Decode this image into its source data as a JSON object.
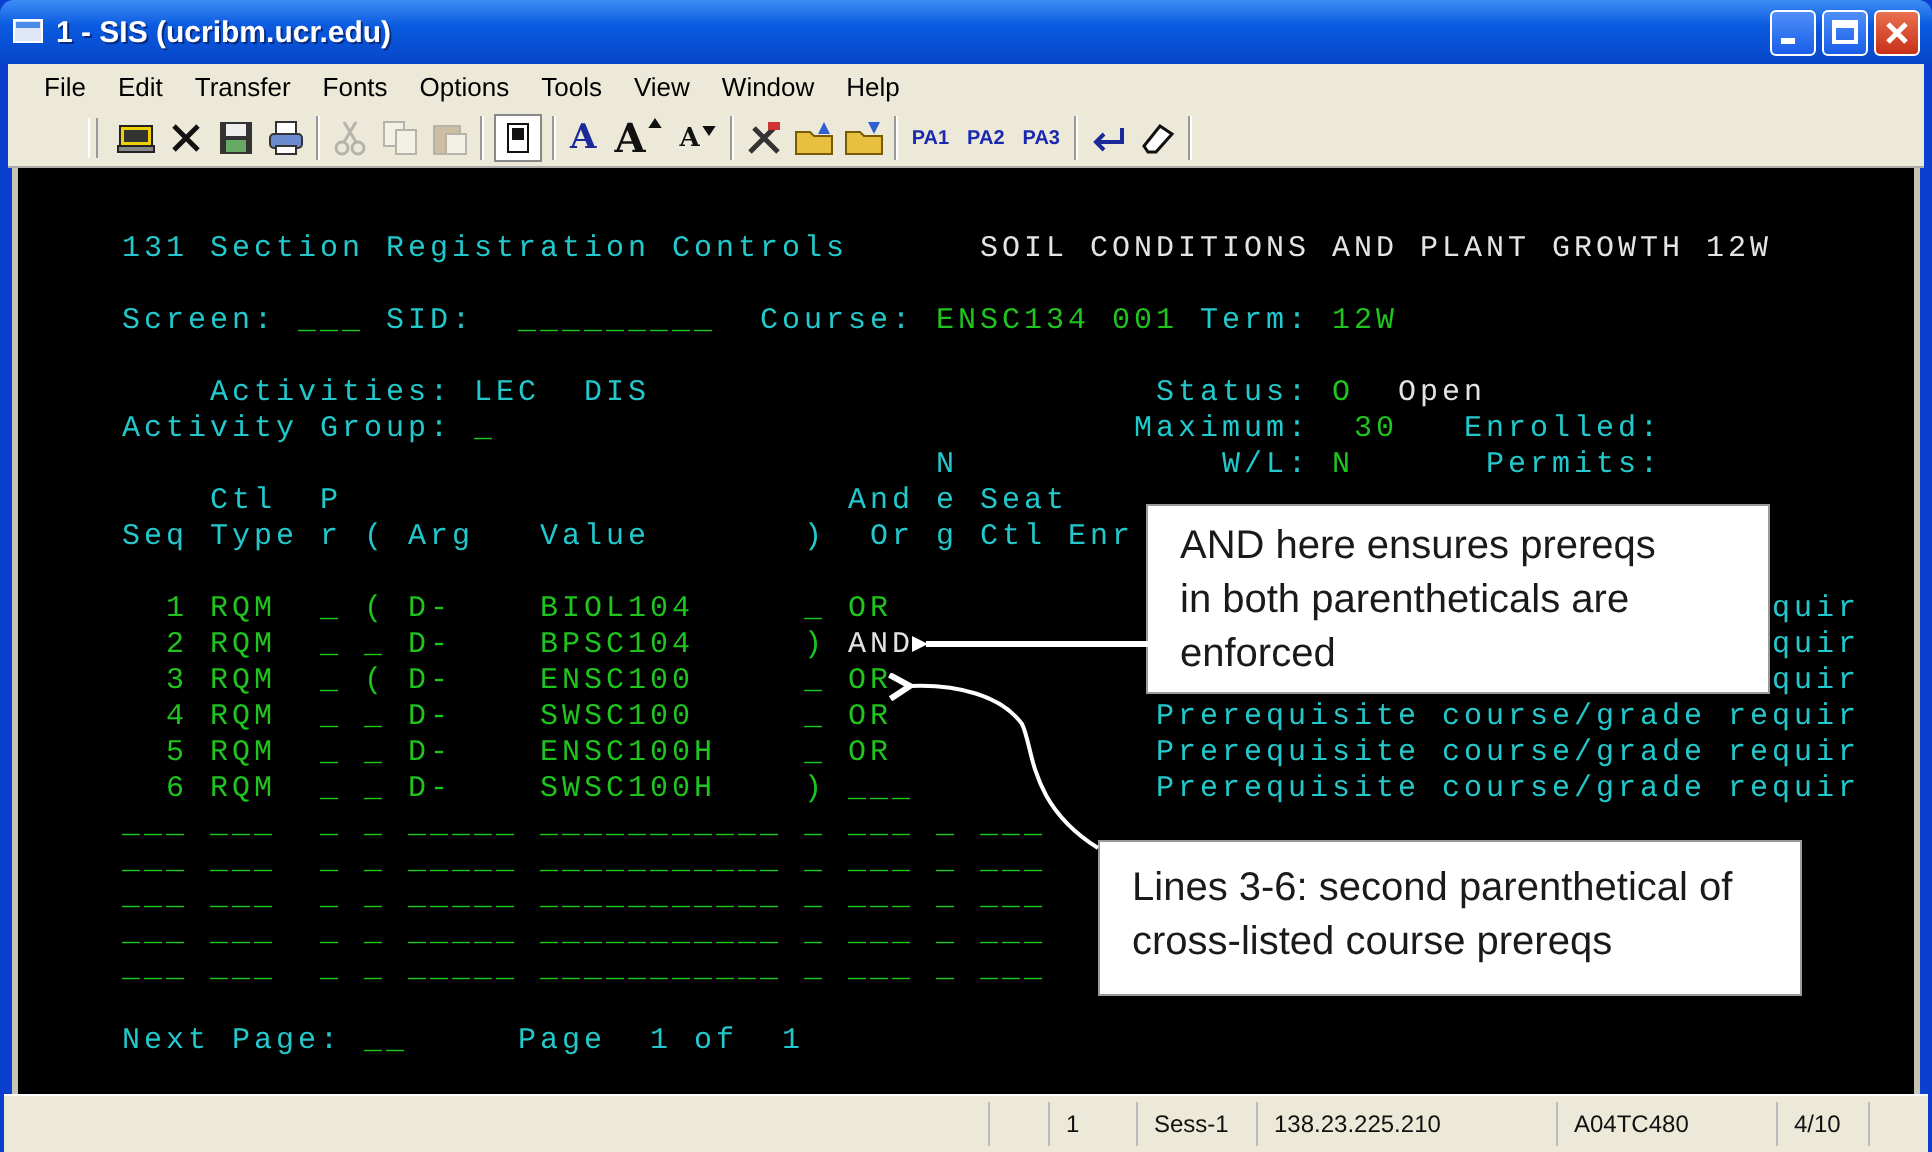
{
  "window": {
    "title": "1 - SIS (ucribm.ucr.edu)"
  },
  "menu": [
    "File",
    "Edit",
    "Transfer",
    "Fonts",
    "Options",
    "Tools",
    "View",
    "Window",
    "Help"
  ],
  "toolbar": {
    "clipboard_buttons": [
      {
        "disabled": true
      },
      {
        "disabled": true
      },
      {
        "disabled": true
      }
    ],
    "font_buttons": [
      {
        "label": "A",
        "kind": "plain"
      },
      {
        "label": "A",
        "kind": "grow"
      },
      {
        "label": "A",
        "kind": "shrink"
      }
    ],
    "pa_buttons": [
      "PA1",
      "PA2",
      "PA3"
    ]
  },
  "terminal": {
    "lines": [
      [
        {
          "text": "131 Section Registration Controls",
          "kind": "label"
        },
        {
          "text": "SOIL CONDITIONS AND PLANT GROWTH 12W",
          "kind": "bright"
        }
      ],
      [
        {
          "text": "Screen:",
          "kind": "label"
        },
        {
          "text": "___",
          "kind": "field"
        },
        {
          "text": "SID:",
          "kind": "label"
        },
        {
          "text": "_________",
          "kind": "field"
        },
        {
          "text": "Course:",
          "kind": "label"
        },
        {
          "text": "ENSC134 001",
          "kind": "value"
        },
        {
          "text": "Term:",
          "kind": "label"
        },
        {
          "text": "12W",
          "kind": "value"
        }
      ],
      [
        {
          "text": "Activities:",
          "kind": "label"
        },
        {
          "text": "LEC  DIS",
          "kind": "label"
        },
        {
          "text": "Status:",
          "kind": "label"
        },
        {
          "text": "O",
          "kind": "value"
        },
        {
          "text": "Open",
          "kind": "bright"
        }
      ],
      [
        {
          "text": "Activity Group:",
          "kind": "label"
        },
        {
          "text": "_",
          "kind": "field"
        },
        {
          "text": "Maximum:",
          "kind": "label"
        },
        {
          "text": "30",
          "kind": "value"
        },
        {
          "text": "Enrolled:",
          "kind": "label"
        }
      ],
      [
        {
          "text": "N",
          "kind": "label"
        },
        {
          "text": "W/L:",
          "kind": "label"
        },
        {
          "text": "N",
          "kind": "value"
        },
        {
          "text": "Permits:",
          "kind": "label"
        }
      ],
      [
        {
          "text": "Ctl",
          "kind": "label"
        },
        {
          "text": "P",
          "kind": "label"
        },
        {
          "text": "And",
          "kind": "label"
        },
        {
          "text": "e",
          "kind": "label"
        },
        {
          "text": "Seat",
          "kind": "label"
        }
      ],
      [
        {
          "text": "Seq",
          "kind": "label"
        },
        {
          "text": "Type",
          "kind": "label"
        },
        {
          "text": "r",
          "kind": "label"
        },
        {
          "text": "(",
          "kind": "label"
        },
        {
          "text": "Arg",
          "kind": "label"
        },
        {
          "text": "Value",
          "kind": "label"
        },
        {
          "text": ")",
          "kind": "label"
        },
        {
          "text": "Or",
          "kind": "label"
        },
        {
          "text": "g",
          "kind": "label"
        },
        {
          "text": "Ctl",
          "kind": "label"
        },
        {
          "text": "Enr",
          "kind": "label"
        }
      ],
      [
        {
          "text": "1",
          "kind": "value"
        },
        {
          "text": "RQM",
          "kind": "value"
        },
        {
          "text": "_",
          "kind": "field"
        },
        {
          "text": "(",
          "kind": "field"
        },
        {
          "text": "D-",
          "kind": "value"
        },
        {
          "text": "BIOL104",
          "kind": "value"
        },
        {
          "text": "_",
          "kind": "field"
        },
        {
          "text": "OR",
          "kind": "value"
        },
        {
          "text": "quir",
          "kind": "label"
        }
      ],
      [
        {
          "text": "2",
          "kind": "value"
        },
        {
          "text": "RQM",
          "kind": "value"
        },
        {
          "text": "_",
          "kind": "field"
        },
        {
          "text": "_",
          "kind": "field"
        },
        {
          "text": "D-",
          "kind": "value"
        },
        {
          "text": "BPSC104",
          "kind": "value"
        },
        {
          "text": ")",
          "kind": "field"
        },
        {
          "text": "AND",
          "kind": "bright"
        },
        {
          "text": "quir",
          "kind": "label"
        }
      ],
      [
        {
          "text": "3",
          "kind": "value"
        },
        {
          "text": "RQM",
          "kind": "value"
        },
        {
          "text": "_",
          "kind": "field"
        },
        {
          "text": "(",
          "kind": "field"
        },
        {
          "text": "D-",
          "kind": "value"
        },
        {
          "text": "ENSC100",
          "kind": "value"
        },
        {
          "text": "_",
          "kind": "field"
        },
        {
          "text": "OR",
          "kind": "value"
        },
        {
          "text": "quir",
          "kind": "label"
        }
      ],
      [
        {
          "text": "4",
          "kind": "value"
        },
        {
          "text": "RQM",
          "kind": "value"
        },
        {
          "text": "_",
          "kind": "field"
        },
        {
          "text": "_",
          "kind": "field"
        },
        {
          "text": "D-",
          "kind": "value"
        },
        {
          "text": "SWSC100",
          "kind": "value"
        },
        {
          "text": "_",
          "kind": "field"
        },
        {
          "text": "OR",
          "kind": "value"
        },
        {
          "text": "Prerequisite course/grade requir",
          "kind": "label"
        }
      ],
      [
        {
          "text": "5",
          "kind": "value"
        },
        {
          "text": "RQM",
          "kind": "value"
        },
        {
          "text": "_",
          "kind": "field"
        },
        {
          "text": "_",
          "kind": "field"
        },
        {
          "text": "D-",
          "kind": "value"
        },
        {
          "text": "ENSC100H",
          "kind": "value"
        },
        {
          "text": "_",
          "kind": "field"
        },
        {
          "text": "OR",
          "kind": "value"
        },
        {
          "text": "Prerequisite course/grade requir",
          "kind": "label"
        }
      ],
      [
        {
          "text": "6",
          "kind": "value"
        },
        {
          "text": "RQM",
          "kind": "value"
        },
        {
          "text": "_",
          "kind": "field"
        },
        {
          "text": "_",
          "kind": "field"
        },
        {
          "text": "D-",
          "kind": "value"
        },
        {
          "text": "SWSC100H",
          "kind": "value"
        },
        {
          "text": ")",
          "kind": "field"
        },
        {
          "text": "___",
          "kind": "field"
        },
        {
          "text": "Prerequisite course/grade requir",
          "kind": "label"
        }
      ],
      [
        {
          "text": "___",
          "kind": "field"
        },
        {
          "text": "___",
          "kind": "field"
        },
        {
          "text": "_",
          "kind": "field"
        },
        {
          "text": "_",
          "kind": "field"
        },
        {
          "text": "_____",
          "kind": "field"
        },
        {
          "text": "___________",
          "kind": "field"
        },
        {
          "text": "_",
          "kind": "field"
        },
        {
          "text": "___",
          "kind": "field"
        },
        {
          "text": "_",
          "kind": "field"
        },
        {
          "text": "___",
          "kind": "field"
        }
      ],
      [
        {
          "text": "___",
          "kind": "field"
        },
        {
          "text": "___",
          "kind": "field"
        },
        {
          "text": "_",
          "kind": "field"
        },
        {
          "text": "_",
          "kind": "field"
        },
        {
          "text": "_____",
          "kind": "field"
        },
        {
          "text": "___________",
          "kind": "field"
        },
        {
          "text": "_",
          "kind": "field"
        },
        {
          "text": "___",
          "kind": "field"
        },
        {
          "text": "_",
          "kind": "field"
        },
        {
          "text": "___",
          "kind": "field"
        }
      ],
      [
        {
          "text": "___",
          "kind": "field"
        },
        {
          "text": "___",
          "kind": "field"
        },
        {
          "text": "_",
          "kind": "field"
        },
        {
          "text": "_",
          "kind": "field"
        },
        {
          "text": "_____",
          "kind": "field"
        },
        {
          "text": "___________",
          "kind": "field"
        },
        {
          "text": "_",
          "kind": "field"
        },
        {
          "text": "___",
          "kind": "field"
        },
        {
          "text": "_",
          "kind": "field"
        },
        {
          "text": "___",
          "kind": "field"
        }
      ],
      [
        {
          "text": "___",
          "kind": "field"
        },
        {
          "text": "___",
          "kind": "field"
        },
        {
          "text": "_",
          "kind": "field"
        },
        {
          "text": "_",
          "kind": "field"
        },
        {
          "text": "_____",
          "kind": "field"
        },
        {
          "text": "___________",
          "kind": "field"
        },
        {
          "text": "_",
          "kind": "field"
        },
        {
          "text": "___",
          "kind": "field"
        },
        {
          "text": "_",
          "kind": "field"
        },
        {
          "text": "___",
          "kind": "field"
        }
      ],
      [
        {
          "text": "___",
          "kind": "field"
        },
        {
          "text": "___",
          "kind": "field"
        },
        {
          "text": "_",
          "kind": "field"
        },
        {
          "text": "_",
          "kind": "field"
        },
        {
          "text": "_____",
          "kind": "field"
        },
        {
          "text": "___________",
          "kind": "field"
        },
        {
          "text": "_",
          "kind": "field"
        },
        {
          "text": "___",
          "kind": "field"
        },
        {
          "text": "_",
          "kind": "field"
        },
        {
          "text": "___",
          "kind": "field"
        }
      ],
      [
        {
          "text": "Next Page:",
          "kind": "label"
        },
        {
          "text": "__",
          "kind": "field"
        },
        {
          "text": "Page  1 of  1",
          "kind": "label"
        }
      ]
    ]
  },
  "callouts": [
    "AND here ensures prereqs in both parentheticals are enforced",
    "Lines 3-6:  second parenthetical of cross-listed course prereqs"
  ],
  "status_bar": [
    "1",
    "Sess-1",
    "138.23.225.210",
    "A04TC480",
    "4/10"
  ]
}
